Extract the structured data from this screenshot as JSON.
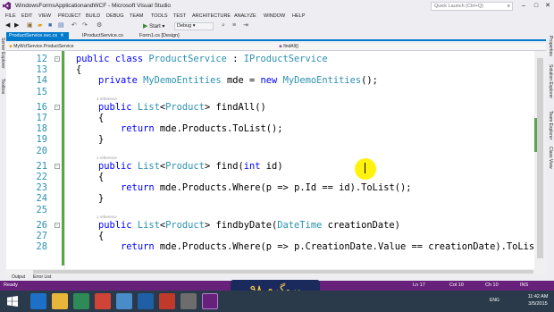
{
  "window": {
    "title": "WindowsFormsApplicationandWCF - Microsoft Visual Studio",
    "quick_launch_placeholder": "Quick Launch (Ctrl+Q)",
    "min": "–",
    "max": "□",
    "close": "✕"
  },
  "menu": [
    "FILE",
    "EDIT",
    "VIEW",
    "PROJECT",
    "BUILD",
    "DEBUG",
    "TEAM",
    "TOOLS",
    "TEST",
    "ARCHITECTURE",
    "ANALYZE",
    "WINDOW",
    "HELP"
  ],
  "toolbar": {
    "start_label": "Start",
    "config": "Debug"
  },
  "side_panels": {
    "left": [
      "Server Explorer",
      "Toolbox"
    ],
    "right": [
      "Properties",
      "Solution Explorer",
      "Team Explorer",
      "Class View"
    ]
  },
  "tabs": [
    {
      "label": "ProductService.svc.cs",
      "active": true
    },
    {
      "label": "IProductService.cs",
      "active": false
    },
    {
      "label": "Form1.cs [Design]",
      "active": false
    }
  ],
  "navbar": {
    "type": "MyWcfService.ProductService",
    "member": "findAll()"
  },
  "code": {
    "reference_label": "1 reference",
    "lines": [
      {
        "n": "12",
        "text": "public class ProductService : IProductService"
      },
      {
        "n": "13",
        "text": "{"
      },
      {
        "n": "14",
        "text": "    private MyDemoEntities mde = new MyDemoEntities();"
      },
      {
        "n": "15",
        "text": ""
      },
      {
        "n": "16",
        "text": "    public List<Product> findAll()"
      },
      {
        "n": "17",
        "text": "    {"
      },
      {
        "n": "18",
        "text": "        return mde.Products.ToList();"
      },
      {
        "n": "19",
        "text": "    }"
      },
      {
        "n": "20",
        "text": ""
      },
      {
        "n": "21",
        "text": "    public List<Product> find(int id)"
      },
      {
        "n": "22",
        "text": "    {"
      },
      {
        "n": "23",
        "text": "        return mde.Products.Where(p => p.Id == id).ToList();"
      },
      {
        "n": "24",
        "text": "    }"
      },
      {
        "n": "25",
        "text": ""
      },
      {
        "n": "26",
        "text": "    public List<Product> findbyDate(DateTime creationDate)"
      },
      {
        "n": "27",
        "text": "    {"
      },
      {
        "n": "28",
        "text": "        return mde.Products.Where(p => p.CreationDate.Value == creationDate).ToList"
      }
    ]
  },
  "bottom_tabs": [
    "Output",
    "Error List"
  ],
  "status": {
    "ready": "Ready",
    "line": "Ln 17",
    "col": "Col 10",
    "ch": "Ch 10",
    "mode": "INS"
  },
  "banner": {
    "text": "پروگرم ۹۸"
  },
  "taskbar": {
    "lang": "ENG",
    "time": "11:42 AM",
    "date": "3/5/2015"
  },
  "colors": {
    "accent": "#007acc",
    "status_bar": "#68217a",
    "keyword": "#0000ff",
    "type": "#2b91af",
    "change_marker": "#57a64a",
    "cursor_highlight": "#fff200"
  }
}
